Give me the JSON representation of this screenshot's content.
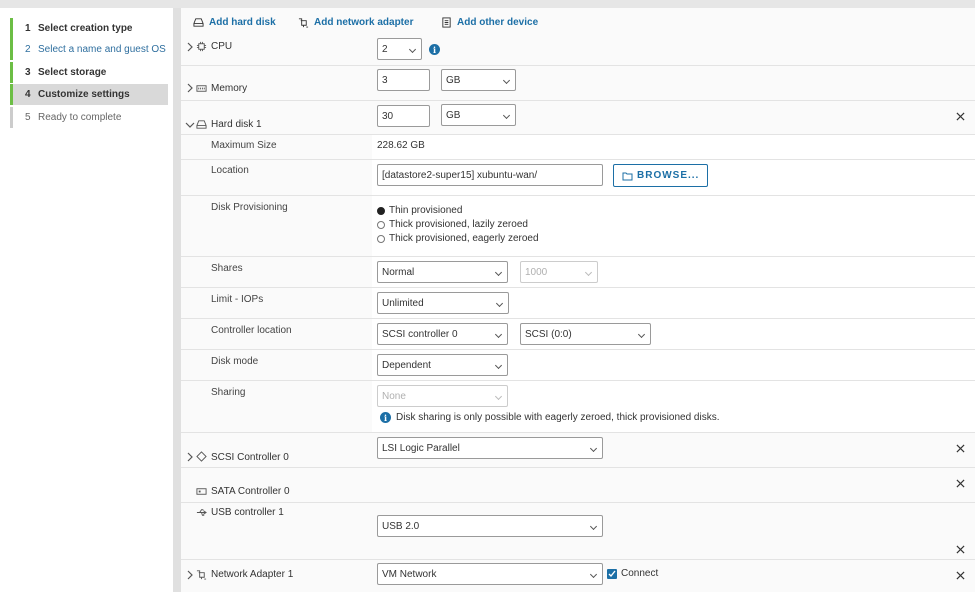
{
  "wizard": {
    "steps": [
      {
        "num": "1",
        "label": "Select creation type"
      },
      {
        "num": "2",
        "label": "Select a name and guest OS"
      },
      {
        "num": "3",
        "label": "Select storage"
      },
      {
        "num": "4",
        "label": "Customize settings"
      },
      {
        "num": "5",
        "label": "Ready to complete"
      }
    ]
  },
  "toolbar": {
    "add_hard_disk": "Add hard disk",
    "add_network_adapter": "Add network adapter",
    "add_other_device": "Add other device"
  },
  "cpu": {
    "label": "CPU",
    "value": "2"
  },
  "memory": {
    "label": "Memory",
    "value": "3",
    "unit": "GB"
  },
  "hard_disk": {
    "label": "Hard disk 1",
    "value": "30",
    "unit": "GB",
    "max_size_label": "Maximum Size",
    "max_size_value": "228.62 GB",
    "location_label": "Location",
    "location_value": "[datastore2-super15] xubuntu-wan/",
    "browse_label": "BROWSE...",
    "provisioning_label": "Disk Provisioning",
    "provisioning_options": [
      "Thin provisioned",
      "Thick provisioned, lazily zeroed",
      "Thick provisioned, eagerly zeroed"
    ],
    "shares_label": "Shares",
    "shares_value": "Normal",
    "shares_number": "1000",
    "limit_label": "Limit - IOPs",
    "limit_value": "Unlimited",
    "controller_label": "Controller location",
    "controller_value": "SCSI controller 0",
    "controller_slot": "SCSI (0:0)",
    "disk_mode_label": "Disk mode",
    "disk_mode_value": "Dependent",
    "sharing_label": "Sharing",
    "sharing_value": "None",
    "sharing_note": "Disk sharing is only possible with eagerly zeroed, thick provisioned disks."
  },
  "scsi": {
    "label": "SCSI Controller 0",
    "value": "LSI Logic Parallel"
  },
  "sata": {
    "label": "SATA Controller 0"
  },
  "usb": {
    "label": "USB controller 1",
    "value": "USB 2.0"
  },
  "network": {
    "label": "Network Adapter 1",
    "value": "VM Network",
    "connect_label": "Connect"
  },
  "colors": {
    "accent": "#1c6fa6",
    "step_done": "#6cbe45"
  }
}
